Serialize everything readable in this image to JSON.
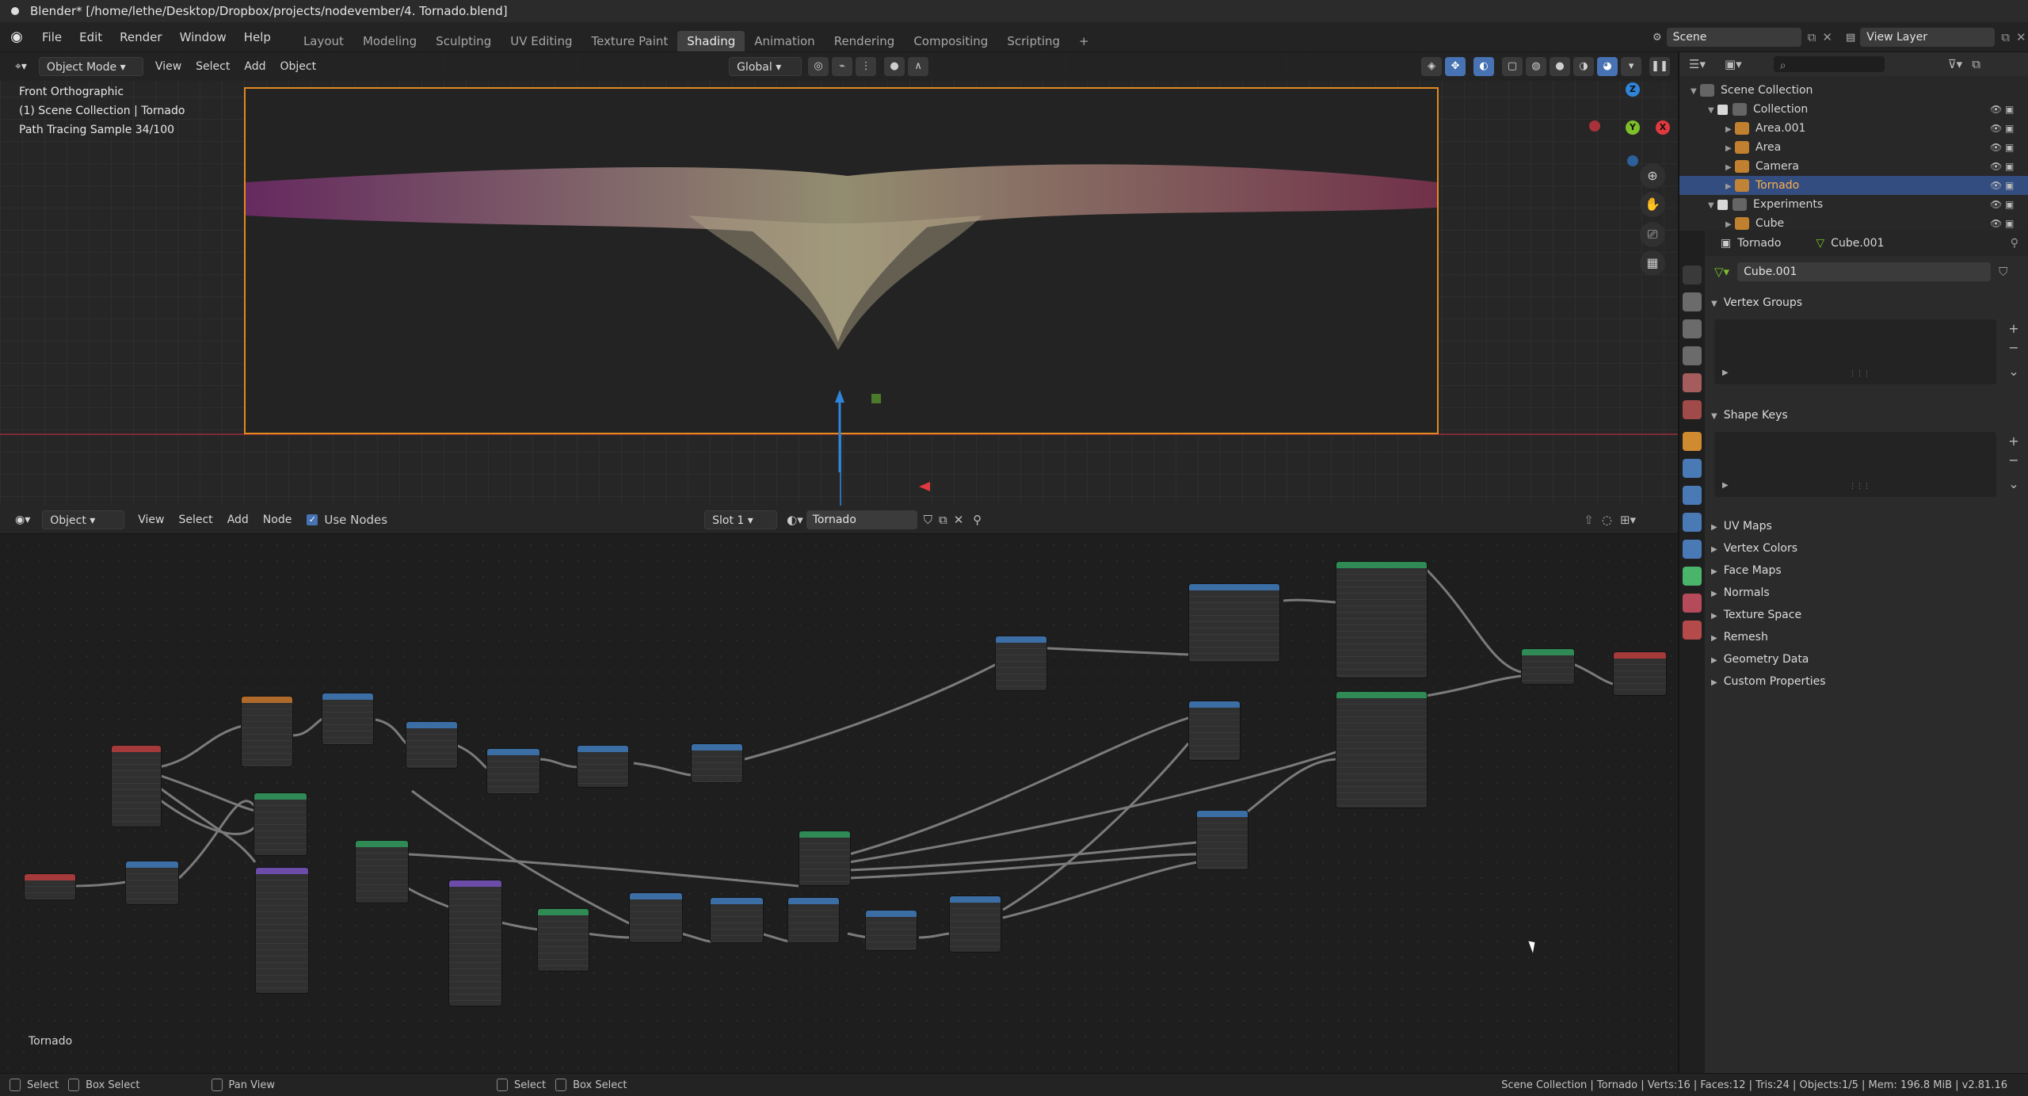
{
  "window": {
    "title": "Blender* [/home/lethe/Desktop/Dropbox/projects/nodevember/4. Tornado.blend]"
  },
  "topbar": {
    "menus": [
      "File",
      "Edit",
      "Render",
      "Window",
      "Help"
    ],
    "workspaces": [
      "Layout",
      "Modeling",
      "Sculpting",
      "UV Editing",
      "Texture Paint",
      "Shading",
      "Animation",
      "Rendering",
      "Compositing",
      "Scripting"
    ],
    "active_workspace": "Shading",
    "scene": "Scene",
    "view_layer": "View Layer"
  },
  "viewport": {
    "mode": "Object Mode",
    "menus": [
      "View",
      "Select",
      "Add",
      "Object"
    ],
    "orientation": "Global",
    "info_lines": [
      "Front Orthographic",
      "(1) Scene Collection | Tornado",
      "Path Tracing Sample 34/100"
    ],
    "gizmo": {
      "z": "Z",
      "y": "Y",
      "x": "X"
    }
  },
  "node_editor": {
    "type": "Object",
    "menus": [
      "View",
      "Select",
      "Add",
      "Node"
    ],
    "use_nodes_label": "Use Nodes",
    "slot": "Slot 1",
    "material": "Tornado",
    "footer_label": "Tornado"
  },
  "outliner": {
    "search_placeholder": "",
    "rows": [
      {
        "label": "Scene Collection",
        "indent": 0,
        "icon": "collection-icon",
        "selected": false
      },
      {
        "label": "Collection",
        "indent": 1,
        "icon": "collection-icon",
        "selected": false
      },
      {
        "label": "Area.001",
        "indent": 2,
        "icon": "light-icon",
        "selected": false
      },
      {
        "label": "Area",
        "indent": 2,
        "icon": "light-icon",
        "selected": false
      },
      {
        "label": "Camera",
        "indent": 2,
        "icon": "camera-icon",
        "selected": false
      },
      {
        "label": "Tornado",
        "indent": 2,
        "icon": "mesh-icon",
        "selected": true
      },
      {
        "label": "Experiments",
        "indent": 1,
        "icon": "collection-icon",
        "selected": false
      },
      {
        "label": "Cube",
        "indent": 2,
        "icon": "mesh-icon",
        "selected": false
      }
    ]
  },
  "properties": {
    "object_name": "Tornado",
    "mesh_name": "Cube.001",
    "datablock_field": "Cube.001",
    "panels_open": [
      "Vertex Groups",
      "Shape Keys"
    ],
    "panels_collapsed": [
      "UV Maps",
      "Vertex Colors",
      "Face Maps",
      "Normals",
      "Texture Space",
      "Remesh",
      "Geometry Data",
      "Custom Properties"
    ]
  },
  "statusbar": {
    "left_hints": [
      "Select",
      "Box Select",
      "Pan View",
      "Select",
      "Box Select"
    ],
    "stats": "Scene Collection | Tornado | Verts:16 | Faces:12 | Tris:24 | Objects:1/5 | Mem: 196.8 MiB | v2.81.16"
  },
  "colors": {
    "accent_blue": "#4772b3",
    "selection_row": "#334d80",
    "camera_frame": "#e2891f",
    "x_axis": "#e0393e",
    "y_axis": "#7cbf2a",
    "z_axis": "#2f85d9"
  }
}
